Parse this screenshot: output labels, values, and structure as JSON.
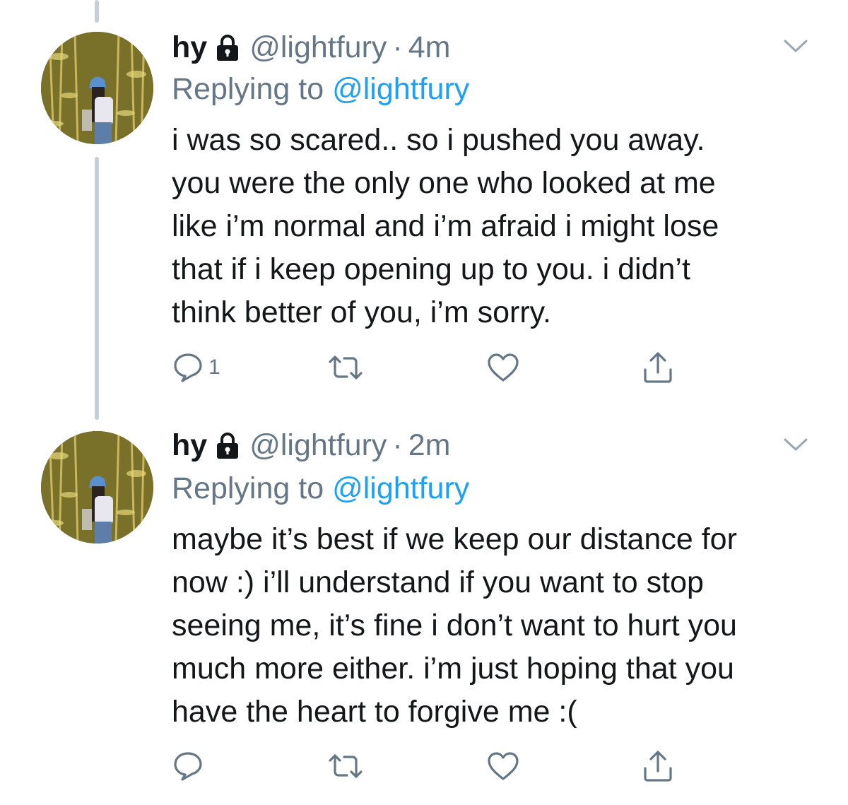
{
  "colors": {
    "text": "#14171a",
    "secondary": "#657786",
    "link": "#1da1f2",
    "thread_line": "#c4cfd6"
  },
  "tweets": [
    {
      "name": "hy",
      "protected_icon": "lock-icon",
      "handle": "@lightfury",
      "dot": "·",
      "time": "4m",
      "replying_prefix": "Replying to ",
      "replying_to": "@lightfury",
      "text": "i was so scared.. so i pushed you away.\nyou were the only one who looked at me\nlike i’m normal and i’m afraid i might lose\nthat if i keep opening up to you. i didn’t\nthink better of you, i’m sorry.",
      "reply_count": "1",
      "icons": [
        "reply-icon",
        "retweet-icon",
        "like-icon",
        "share-icon",
        "chevron-down-icon"
      ]
    },
    {
      "name": "hy",
      "protected_icon": "lock-icon",
      "handle": "@lightfury",
      "dot": "·",
      "time": "2m",
      "replying_prefix": "Replying to ",
      "replying_to": "@lightfury",
      "text": "maybe it’s best if we keep our distance for\nnow :) i’ll understand if you want to stop\nseeing me, it’s fine i don’t want to hurt you\nmuch more either. i’m just hoping that you\nhave the heart to forgive me :(",
      "reply_count": "",
      "icons": [
        "reply-icon",
        "retweet-icon",
        "like-icon",
        "share-icon",
        "chevron-down-icon"
      ]
    }
  ]
}
